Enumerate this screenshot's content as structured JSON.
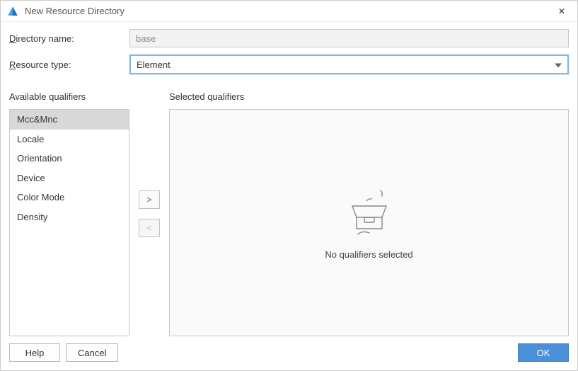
{
  "window": {
    "title": "New Resource Directory",
    "close_glyph": "✕"
  },
  "form": {
    "directory_label_pre": "D",
    "directory_label_rest": "irectory name:",
    "directory_value": "base",
    "resource_label_pre": "R",
    "resource_label_rest": "esource type:",
    "resource_value": "Element"
  },
  "available": {
    "label": "Available qualifiers",
    "items": [
      {
        "label": "Mcc&Mnc",
        "selected": true
      },
      {
        "label": "Locale",
        "selected": false
      },
      {
        "label": "Orientation",
        "selected": false
      },
      {
        "label": "Device",
        "selected": false
      },
      {
        "label": "Color Mode",
        "selected": false
      },
      {
        "label": "Density",
        "selected": false
      }
    ]
  },
  "transfer": {
    "add": ">",
    "remove": "<"
  },
  "selected": {
    "label": "Selected qualifiers",
    "empty_text": "No qualifiers selected"
  },
  "footer": {
    "help": "Help",
    "cancel": "Cancel",
    "ok": "OK"
  }
}
